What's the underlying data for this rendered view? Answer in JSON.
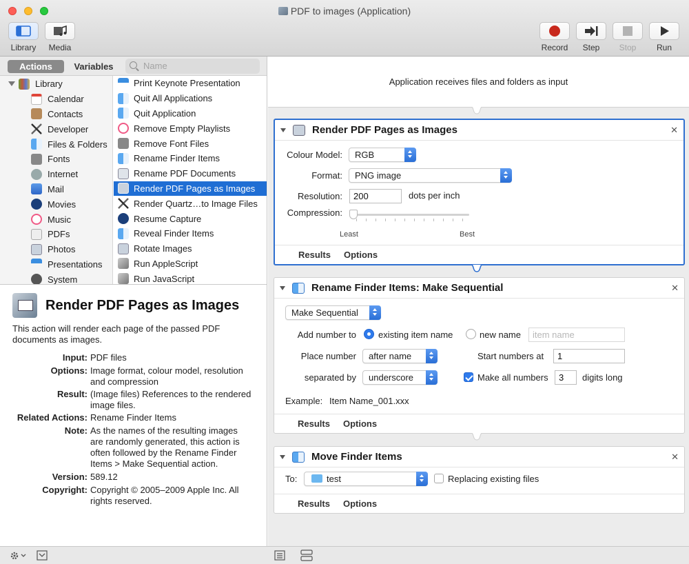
{
  "window": {
    "title": "PDF to images (Application)"
  },
  "toolbar": {
    "library": "Library",
    "media": "Media",
    "record": "Record",
    "step": "Step",
    "stop": "Stop",
    "run": "Run"
  },
  "left": {
    "tabs": {
      "actions": "Actions",
      "variables": "Variables"
    },
    "search_placeholder": "Name",
    "library_root": "Library",
    "library_items": [
      "Calendar",
      "Contacts",
      "Developer",
      "Files & Folders",
      "Fonts",
      "Internet",
      "Mail",
      "Movies",
      "Music",
      "PDFs",
      "Photos",
      "Presentations",
      "System"
    ],
    "actions": [
      "Print Keynote Presentation",
      "Quit All Applications",
      "Quit Application",
      "Remove Empty Playlists",
      "Remove Font Files",
      "Rename Finder Items",
      "Rename PDF Documents",
      "Render PDF Pages as Images",
      "Render Quartz…to Image Files",
      "Resume Capture",
      "Reveal Finder Items",
      "Rotate Images",
      "Run AppleScript",
      "Run JavaScript"
    ],
    "selected_action_index": 7
  },
  "description": {
    "title": "Render PDF Pages as Images",
    "summary": "This action will render each page of the passed PDF documents as images.",
    "fields": [
      {
        "k": "Input:",
        "v": "PDF files"
      },
      {
        "k": "Options:",
        "v": "Image format, colour model, resolution and compression"
      },
      {
        "k": "Result:",
        "v": "(Image files) References to the rendered image files."
      },
      {
        "k": "Related Actions:",
        "v": "Rename Finder Items"
      },
      {
        "k": "Note:",
        "v": "As the names of the resulting images are randomly generated, this action is often followed by the Rename Finder Items > Make Sequential action."
      },
      {
        "k": "Version:",
        "v": "589.12"
      },
      {
        "k": "Copyright:",
        "v": "Copyright © 2005–2009 Apple Inc. All rights reserved."
      }
    ]
  },
  "workflow": {
    "input_text": "Application receives files and folders as input",
    "card1": {
      "title": "Render PDF Pages as Images",
      "colour_model_label": "Colour Model:",
      "colour_model": "RGB",
      "format_label": "Format:",
      "format": "PNG image",
      "resolution_label": "Resolution:",
      "resolution": "200",
      "resolution_unit": "dots per inch",
      "compression_label": "Compression:",
      "compression_min": "Least",
      "compression_max": "Best",
      "compression_value": 0,
      "results": "Results",
      "options": "Options"
    },
    "card2": {
      "title": "Rename Finder Items: Make Sequential",
      "mode": "Make Sequential",
      "add_number_to": "Add number to",
      "existing_item_name": "existing item name",
      "new_name": "new name",
      "item_name_placeholder": "item name",
      "place_number": "Place number",
      "place_value": "after name",
      "start_numbers_at": "Start numbers at",
      "start_value": "1",
      "separated_by": "separated by",
      "separator": "underscore",
      "make_all_numbers": "Make all numbers",
      "digits_value": "3",
      "digits_long": "digits long",
      "example_label": "Example:",
      "example_value": "Item Name_001.xxx",
      "results": "Results",
      "options": "Options"
    },
    "card3": {
      "title": "Move Finder Items",
      "to_label": "To:",
      "folder": "test",
      "replacing": "Replacing existing files",
      "results": "Results",
      "options": "Options"
    }
  },
  "colors": {
    "accent": "#1f6ed4",
    "record": "#c8291d"
  }
}
